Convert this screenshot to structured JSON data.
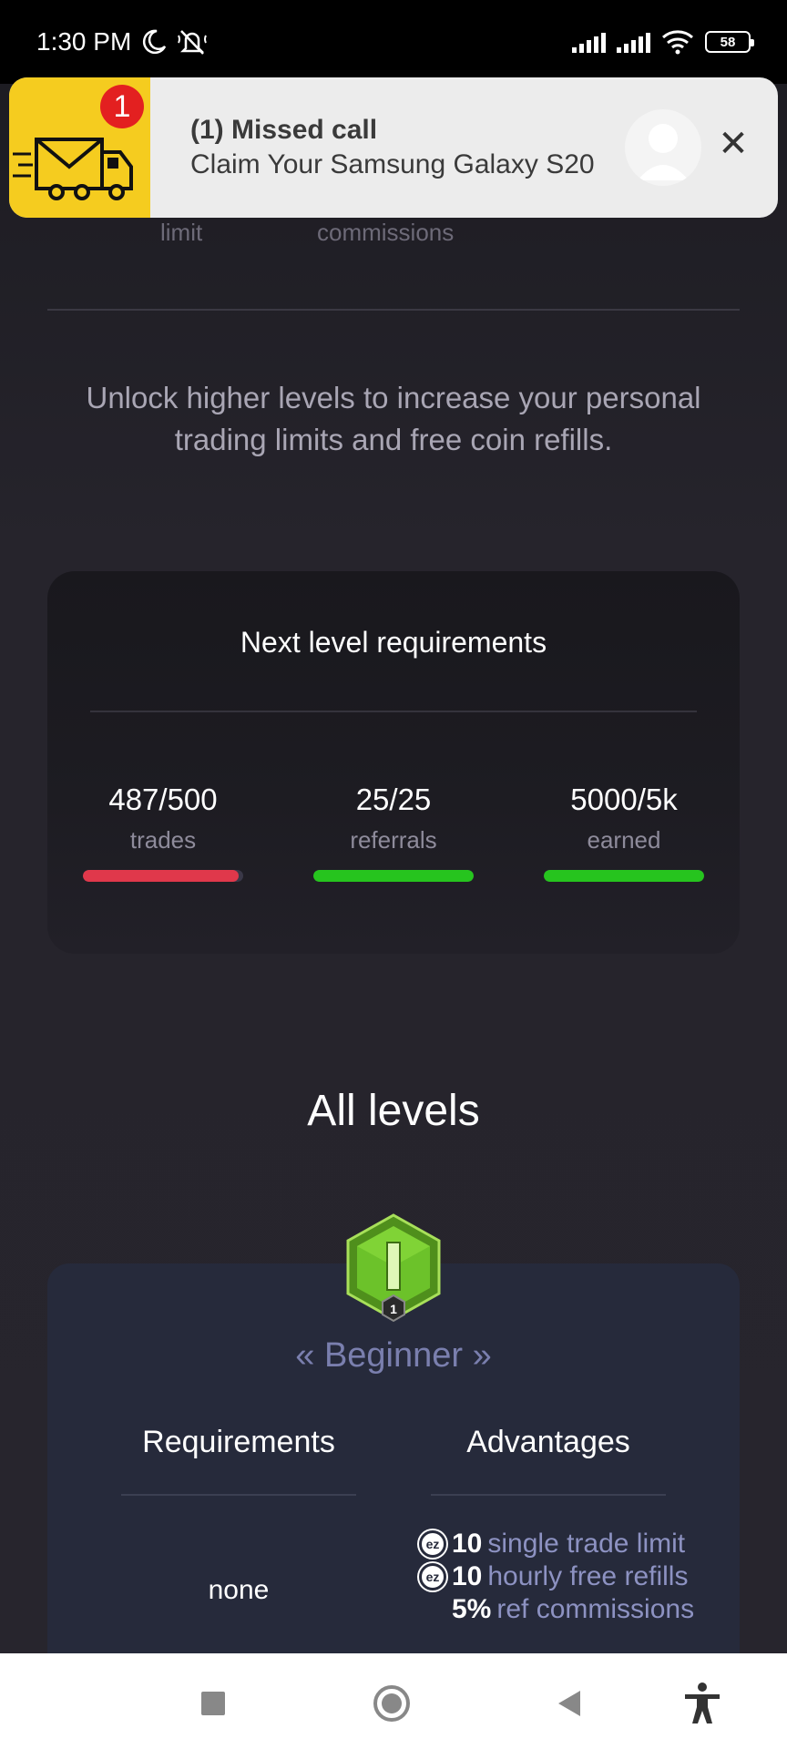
{
  "status_bar": {
    "time": "1:30 PM",
    "battery": "58"
  },
  "notification": {
    "count": "1",
    "title": "(1) Missed call",
    "body": "Claim Your Samsung Galaxy S20"
  },
  "stats_labels": {
    "limit": "limit",
    "commissions": "commissions"
  },
  "unlock_text": "Unlock higher levels to increase your personal trading limits and free coin refills.",
  "requirements": {
    "title": "Next level requirements",
    "items": [
      {
        "value": "487/500",
        "label": "trades",
        "progress": 0.974,
        "color": "#e0384b"
      },
      {
        "value": "25/25",
        "label": "referrals",
        "progress": 1.0,
        "color": "#26c41e"
      },
      {
        "value": "5000/5k",
        "label": "earned",
        "progress": 1.0,
        "color": "#26c41e"
      }
    ]
  },
  "all_levels": {
    "title": "All levels",
    "badge_number": "1",
    "level_name": "« Beginner »",
    "requirements_header": "Requirements",
    "advantages_header": "Advantages",
    "requirements_value": "none",
    "advantages": [
      {
        "amount": "10",
        "text": "single trade limit",
        "icon": "ez-coin-icon"
      },
      {
        "amount": "10",
        "text": "hourly free refills",
        "icon": "ez-coin-icon"
      },
      {
        "amount": "5%",
        "text": "ref commissions",
        "icon": ""
      }
    ]
  },
  "colors": {
    "background": "#25232b",
    "accent_red": "#e0384b",
    "accent_green": "#26c41e",
    "level_text": "#7a7fae"
  }
}
